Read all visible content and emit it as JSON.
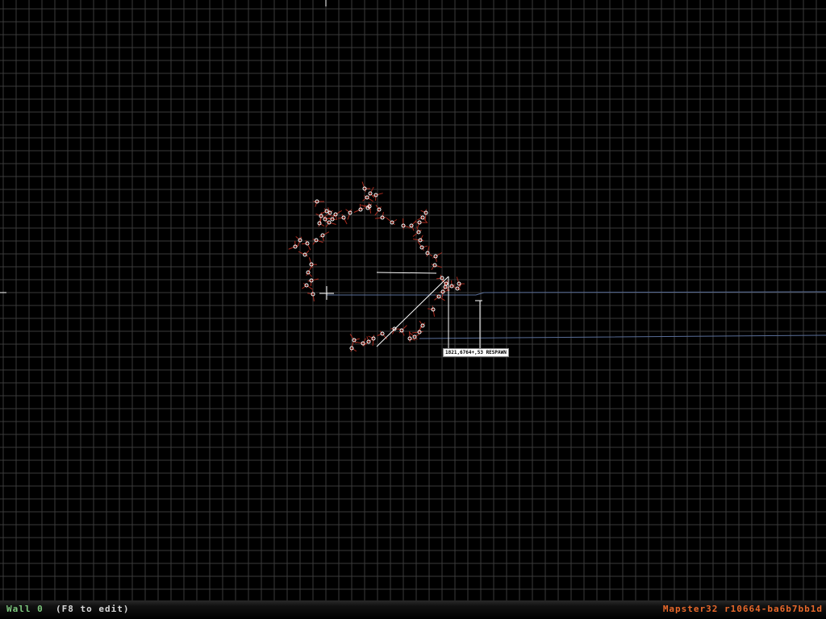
{
  "statusbar": {
    "wall_label": "Wall 0",
    "edit_hint": "(F8 to edit)",
    "version": "Mapster32 r10664-ba6b7bb1d"
  },
  "map": {
    "sprite_label": "1821,6764+,53 RESPAWN"
  },
  "colors": {
    "background": "#000000",
    "grid": "#3a3a3a",
    "wall": "#ffffff",
    "vertex": "#ffffff",
    "sprite": "#a82a1e",
    "blue_wall": "#5a6f9a",
    "version_text": "#e8682a",
    "wall_label_text": "#7ec87e"
  }
}
